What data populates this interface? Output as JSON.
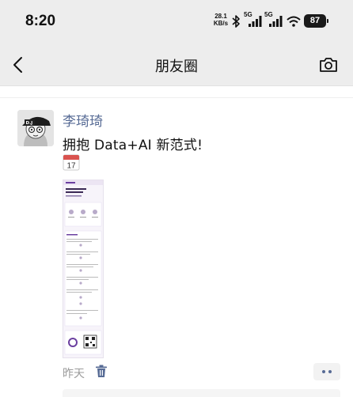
{
  "status_bar": {
    "time": "8:20",
    "net_speed_value": "28.1",
    "net_speed_unit": "KB/s",
    "sim1_label": "5G",
    "sim2_label": "5G",
    "battery_level": "87"
  },
  "nav": {
    "title": "朋友圈",
    "back_icon": "chevron-left-icon",
    "camera_icon": "camera-icon"
  },
  "post": {
    "author": "李琦琦",
    "text": "拥抱 Data+AI 新范式!",
    "calendar_day": "17",
    "timestamp": "昨天",
    "link_color": "#576b95",
    "accent_color": "#6b3fa0"
  }
}
